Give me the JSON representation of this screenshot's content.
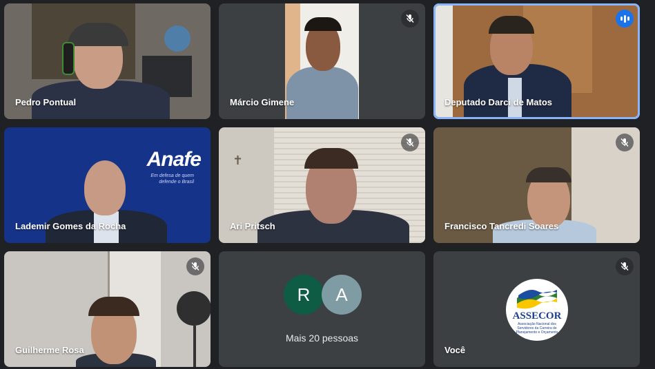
{
  "participants": [
    {
      "name": "Pedro Pontual",
      "muted": false
    },
    {
      "name": "Márcio Gimene",
      "muted": true
    },
    {
      "name": "Deputado Darci de Matos",
      "muted": false,
      "speaking": true
    },
    {
      "name": "Lademir Gomes da Rocha",
      "muted": false
    },
    {
      "name": "Ari Pritsch",
      "muted": true
    },
    {
      "name": "Francisco Tancredi Soares",
      "muted": true
    },
    {
      "name": "Guilherme Rosa",
      "muted": true
    },
    {
      "name": "Você",
      "muted": true
    }
  ],
  "more": {
    "avatars": [
      {
        "initial": "R",
        "color": "#0f5c44"
      },
      {
        "initial": "A",
        "color": "#7f9ba3"
      }
    ],
    "label": "Mais 20 pessoas"
  },
  "anafe": {
    "logo": "Anafe",
    "subtitle": "Em defesa de quem\ndefende o Brasil"
  },
  "assecor": {
    "name": "ASSECOR",
    "subtitle": "Associação Nacional dos Servidores da Carreira de Planejamento e Orçamento"
  },
  "icons": {
    "muted": "mic-off-icon",
    "speaking": "audio-level-icon"
  },
  "colors": {
    "background": "#202124",
    "tile": "#3c4043",
    "speaking_border": "#8ab4f8",
    "speaking_badge": "#1a73e8"
  }
}
